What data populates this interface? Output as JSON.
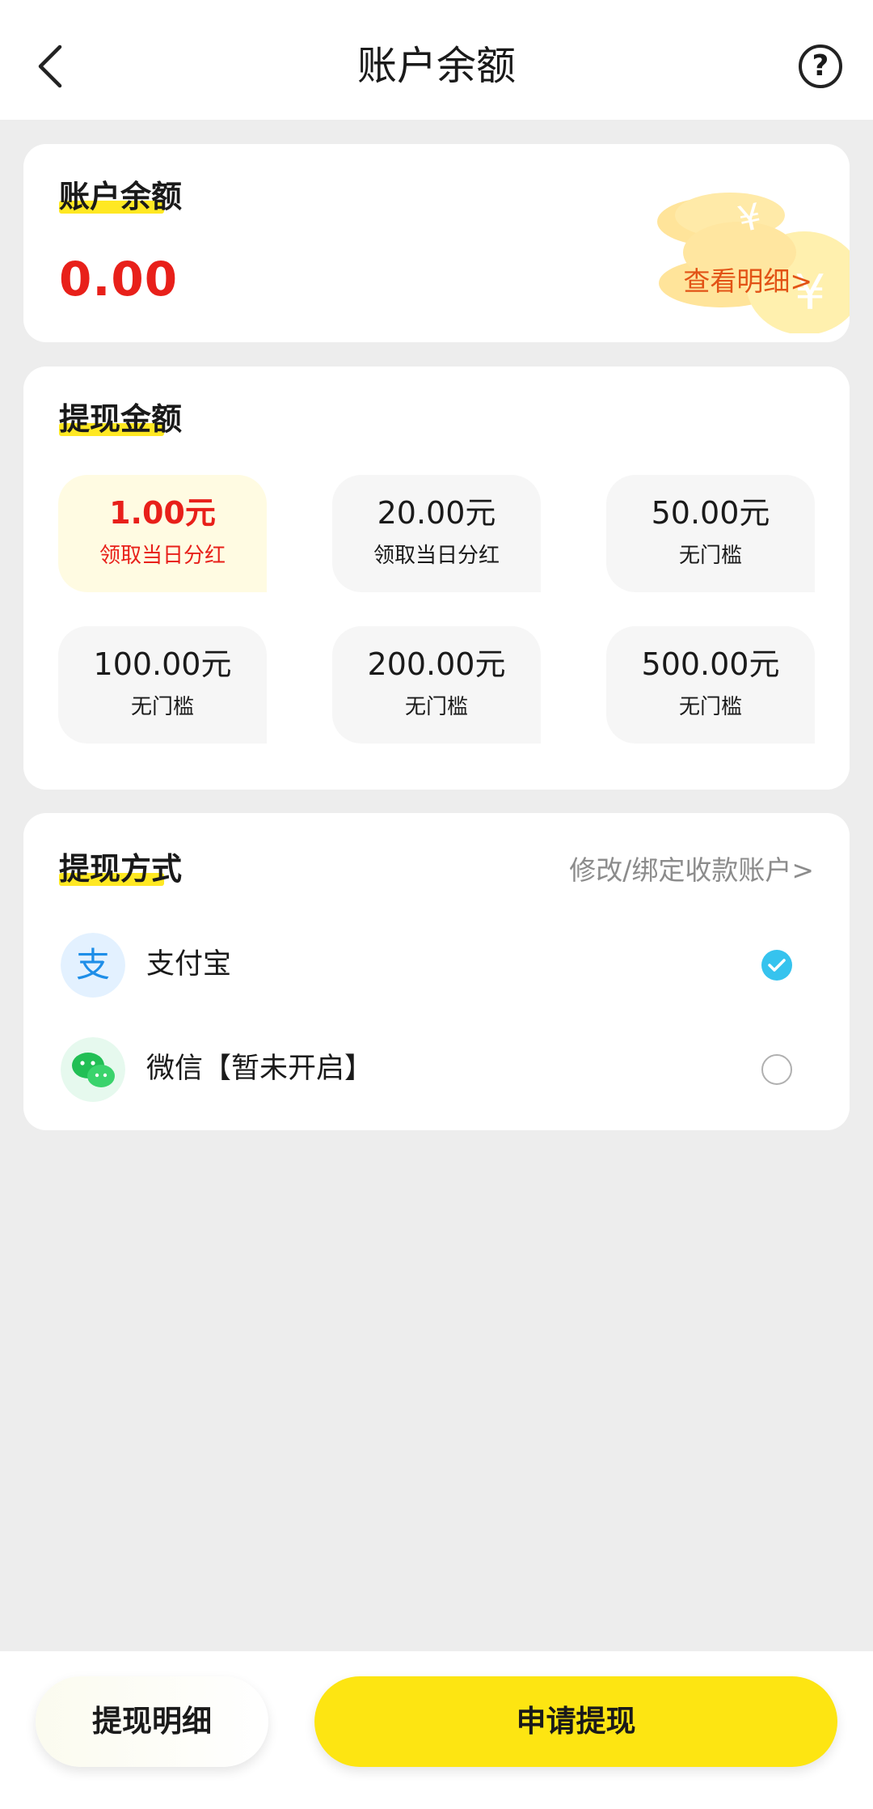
{
  "header": {
    "title": "账户余额",
    "back_icon": "chevron-left-icon",
    "help_label": "?"
  },
  "balance": {
    "title": "账户余额",
    "value": "0.00",
    "view_detail": "查看明细>"
  },
  "withdraw_amount": {
    "title": "提现金额",
    "options": [
      {
        "value": "1.00元",
        "note": "领取当日分红",
        "selected": true
      },
      {
        "value": "20.00元",
        "note": "领取当日分红",
        "selected": false
      },
      {
        "value": "50.00元",
        "note": "无门槛",
        "selected": false
      },
      {
        "value": "100.00元",
        "note": "无门槛",
        "selected": false
      },
      {
        "value": "200.00元",
        "note": "无门槛",
        "selected": false
      },
      {
        "value": "500.00元",
        "note": "无门槛",
        "selected": false
      }
    ]
  },
  "withdraw_method": {
    "title": "提现方式",
    "modify_link": "修改/绑定收款账户>",
    "methods": [
      {
        "label": "支付宝",
        "icon": "alipay-icon",
        "checked": true
      },
      {
        "label": "微信【暂未开启】",
        "icon": "wechat-icon",
        "checked": false
      }
    ]
  },
  "bottom": {
    "history_label": "提现明细",
    "apply_label": "申请提现"
  },
  "colors": {
    "accent_yellow": "#fde512",
    "highlight_red": "#e8201a",
    "detail_orange": "#e25316",
    "check_blue": "#36c3ee"
  }
}
